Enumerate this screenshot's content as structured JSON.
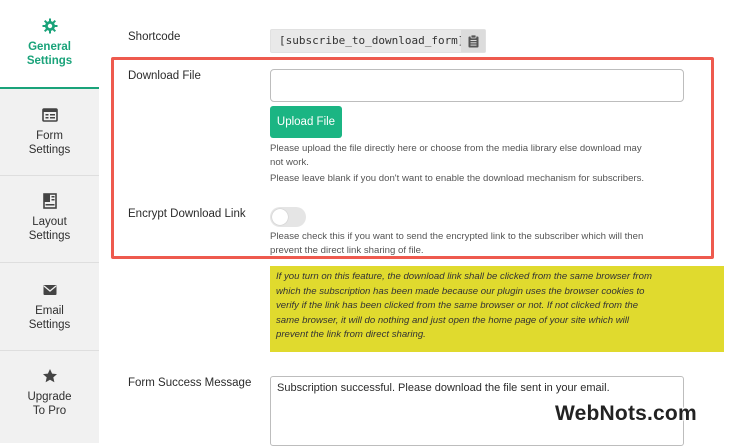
{
  "sidebar": {
    "items": [
      {
        "label_line1": "General",
        "label_line2": "Settings",
        "icon": "gear-icon",
        "active": true
      },
      {
        "label_line1": "Form",
        "label_line2": "Settings",
        "icon": "form-icon",
        "active": false
      },
      {
        "label_line1": "Layout",
        "label_line2": "Settings",
        "icon": "layout-icon",
        "active": false
      },
      {
        "label_line1": "Email",
        "label_line2": "Settings",
        "icon": "envelope-icon",
        "active": false
      },
      {
        "label_line1": "Upgrade",
        "label_line2": "To Pro",
        "icon": "star-icon",
        "active": false
      }
    ]
  },
  "shortcode": {
    "label": "Shortcode",
    "value": "[subscribe_to_download_form]",
    "copy_icon": "clipboard-icon"
  },
  "download_file": {
    "label": "Download File",
    "value": "",
    "upload_label": "Upload File",
    "help_line1": "Please upload the file directly here or choose from the media library else download may",
    "help_line2": "not work.",
    "help_line3": "Please leave blank if you don't want to enable the download mechanism for subscribers."
  },
  "encrypt_link": {
    "label": "Encrypt Download Link",
    "enabled": false,
    "help_line1": "Please check this if you want to send the encrypted link to the subscriber which will then",
    "help_line2": "prevent the direct link sharing of file."
  },
  "note": {
    "line1": "If you turn on this feature, the download link shall be clicked from the same browser from",
    "line2": "which the subscription has been made because our plugin uses the browser cookies to",
    "line3": "verify if the link has been clicked from the same browser or not. If not clicked from the",
    "line4": "same browser, it will do nothing and just open the home page of your site which will",
    "line5": "prevent the link from direct sharing."
  },
  "form_success": {
    "label": "Form Success Message",
    "value": "Subscription successful. Please download the file sent in your email."
  },
  "watermark": "WebNots.com",
  "colors": {
    "accent": "#1bb583",
    "highlight_frame": "#ee5a4e",
    "note_background": "#e0da2e",
    "sidebar_background": "#f1f1f1"
  }
}
